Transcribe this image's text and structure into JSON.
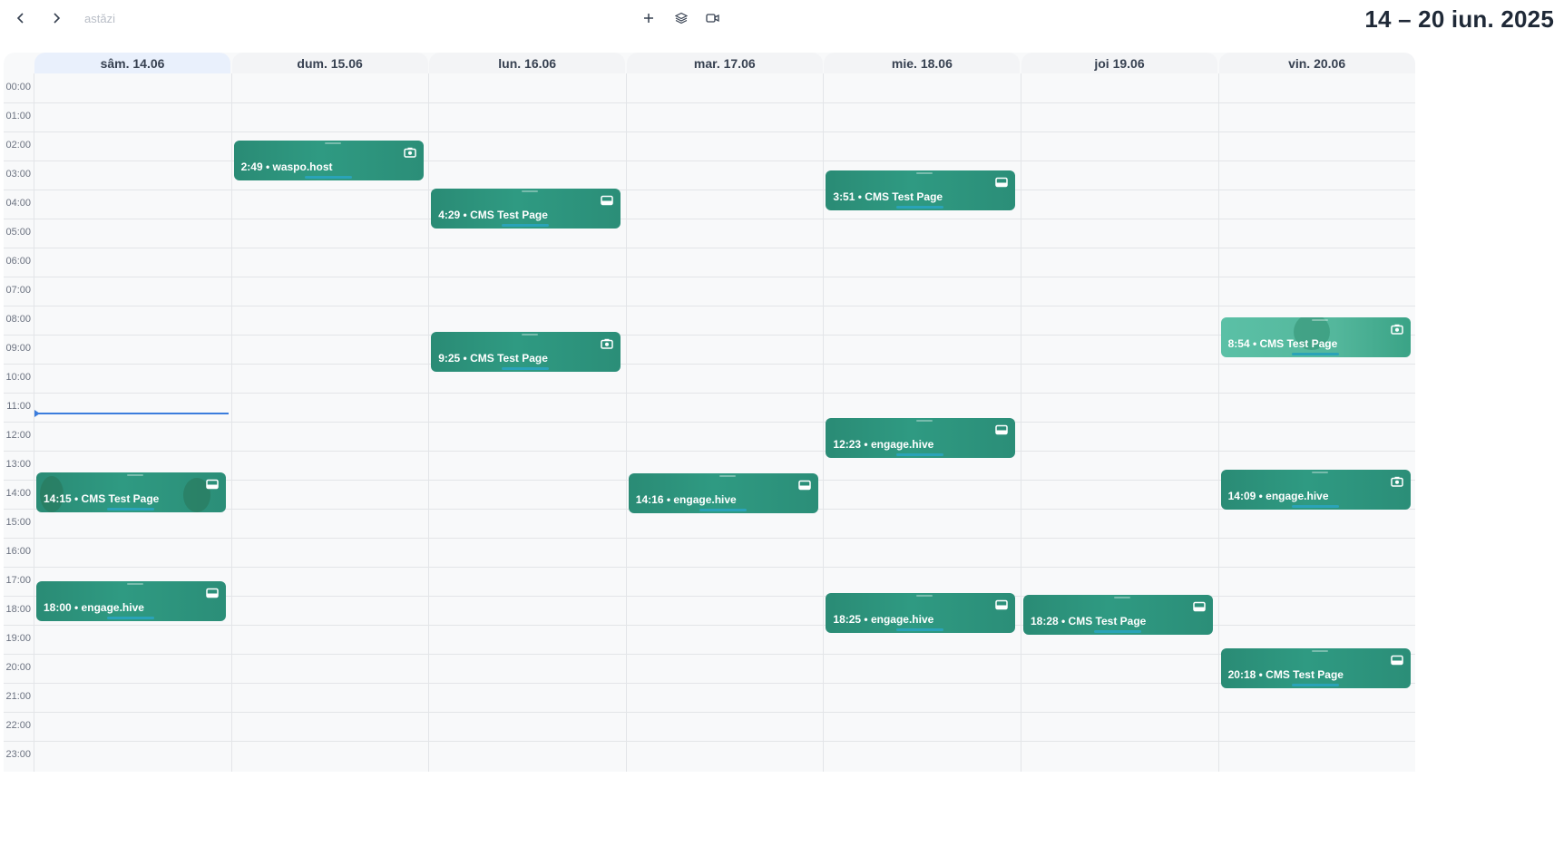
{
  "toolbar": {
    "prev_icon": "chevron-left-icon",
    "next_icon": "chevron-right-icon",
    "today_label": "astăzi",
    "add_icon": "plus-icon",
    "layers_icon": "layers-icon",
    "video_icon": "video-camera-icon",
    "week_title": "14 – 20 iun. 2025"
  },
  "days": [
    {
      "label": "sâm. 14.06",
      "today": true
    },
    {
      "label": "dum. 15.06",
      "today": false
    },
    {
      "label": "lun. 16.06",
      "today": false
    },
    {
      "label": "mar. 17.06",
      "today": false
    },
    {
      "label": "mie. 18.06",
      "today": false
    },
    {
      "label": "joi 19.06",
      "today": false
    },
    {
      "label": "vin. 20.06",
      "today": false
    }
  ],
  "hours": [
    "00:00",
    "01:00",
    "02:00",
    "03:00",
    "04:00",
    "05:00",
    "06:00",
    "07:00",
    "08:00",
    "09:00",
    "10:00",
    "11:00",
    "12:00",
    "13:00",
    "14:00",
    "15:00",
    "16:00",
    "17:00",
    "18:00",
    "19:00",
    "20:00",
    "21:00",
    "22:00",
    "23:00"
  ],
  "now_time": "11:10",
  "events": [
    {
      "day": 1,
      "time": "2:49",
      "title": "waspo.host",
      "label": "2:49 • waspo.host",
      "icon": "camera-icon"
    },
    {
      "day": 2,
      "time": "4:29",
      "title": "CMS Test Page",
      "label": "4:29 • CMS Test Page",
      "icon": "tray-icon"
    },
    {
      "day": 4,
      "time": "3:51",
      "title": "CMS Test Page",
      "label": "3:51 • CMS Test Page",
      "icon": "tray-icon"
    },
    {
      "day": 6,
      "time": "8:54",
      "title": "CMS Test Page",
      "label": "8:54 • CMS Test Page",
      "icon": "camera-icon",
      "light": true
    },
    {
      "day": 2,
      "time": "9:25",
      "title": "CMS Test Page",
      "label": "9:25 • CMS Test Page",
      "icon": "camera-icon"
    },
    {
      "day": 4,
      "time": "12:23",
      "title": "engage.hive",
      "label": "12:23 • engage.hive",
      "icon": "tray-icon"
    },
    {
      "day": 0,
      "time": "14:15",
      "title": "CMS Test Page",
      "label": "14:15 • CMS Test Page",
      "icon": "tray-icon",
      "illustrated": true
    },
    {
      "day": 3,
      "time": "14:16",
      "title": "engage.hive",
      "label": "14:16 • engage.hive",
      "icon": "tray-icon"
    },
    {
      "day": 6,
      "time": "14:09",
      "title": "engage.hive",
      "label": "14:09 • engage.hive",
      "icon": "camera-icon"
    },
    {
      "day": 0,
      "time": "18:00",
      "title": "engage.hive",
      "label": "18:00 • engage.hive",
      "icon": "tray-icon"
    },
    {
      "day": 4,
      "time": "18:25",
      "title": "engage.hive",
      "label": "18:25 • engage.hive",
      "icon": "tray-icon"
    },
    {
      "day": 5,
      "time": "18:28",
      "title": "CMS Test Page",
      "label": "18:28 • CMS Test Page",
      "icon": "tray-icon"
    },
    {
      "day": 6,
      "time": "20:18",
      "title": "CMS Test Page",
      "label": "20:18 • CMS Test Page",
      "icon": "tray-icon"
    }
  ]
}
